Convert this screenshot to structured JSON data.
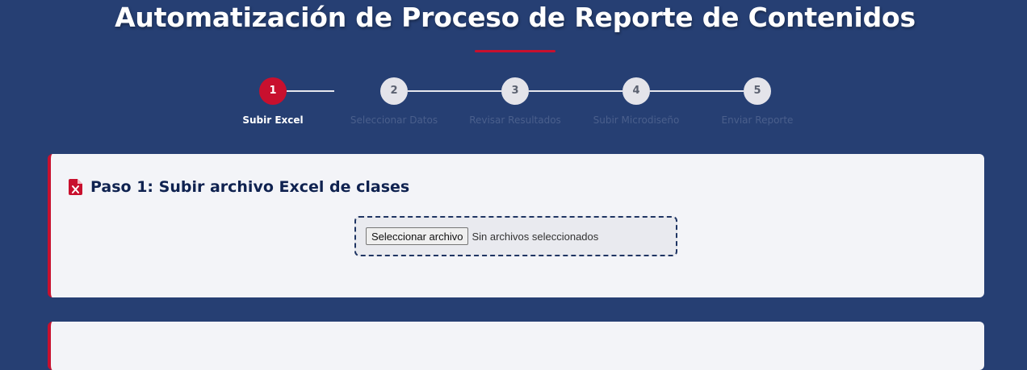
{
  "header": {
    "title": "Automatización de Proceso de Reporte de Contenidos"
  },
  "stepper": {
    "current_step": 1,
    "steps": [
      {
        "number": "1",
        "label": "Subir Excel"
      },
      {
        "number": "2",
        "label": "Seleccionar Datos"
      },
      {
        "number": "3",
        "label": "Revisar Resultados"
      },
      {
        "number": "4",
        "label": "Subir Microdiseño"
      },
      {
        "number": "5",
        "label": "Enviar Reporte"
      }
    ]
  },
  "step1_card": {
    "icon": "file-excel-icon",
    "title": "Paso 1: Subir archivo Excel de clases",
    "file_button_label": "Seleccionar archivo",
    "file_status": "Sin archivos seleccionados"
  },
  "colors": {
    "background": "#263f73",
    "accent": "#c8102e",
    "card": "#f3f4f8",
    "card_title": "#0f2250",
    "inactive_step": "#e4e4ea"
  }
}
